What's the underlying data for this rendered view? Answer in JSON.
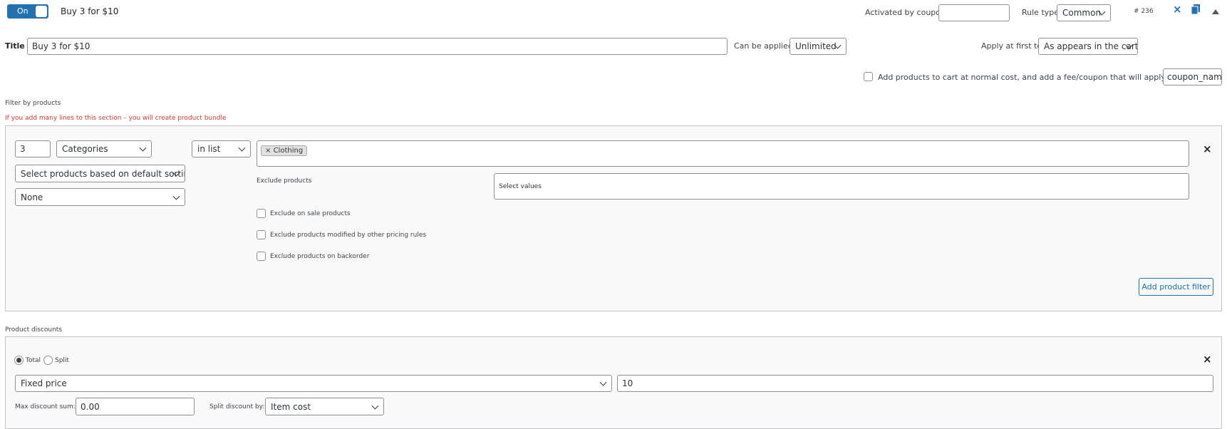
{
  "header": {
    "toggle_label": "On",
    "rule_name": "Buy 3 for $10",
    "activated_by_coupon_label": "Activated by coupon",
    "activated_by_coupon_value": "",
    "rule_type_label": "Rule type",
    "rule_type_value": "Common",
    "rule_id": "# 236"
  },
  "title_row": {
    "title_label": "Title",
    "title_value": "Buy 3 for $10",
    "can_be_applied_label": "Can be applied:",
    "can_be_applied_value": "Unlimited",
    "apply_first_label": "Apply at first to:",
    "apply_first_value": "As appears in the cart"
  },
  "fee_row": {
    "label": "Add products to cart at normal cost, and add a fee/coupon that will apply that cost",
    "coupon_value": "coupon_name"
  },
  "filter_section": {
    "title": "Filter by products",
    "warning": "If you add many lines to this section – you will create product bundle",
    "qty": "3",
    "filter_type": "Categories",
    "condition": "in list",
    "selected_tag": "Clothing",
    "sorting": "Select products based on default sorting",
    "none_option": "None",
    "exclude_products_label": "Exclude products",
    "exclude_placeholder": "Select values",
    "exclude_on_sale": "Exclude on sale products",
    "exclude_modified": "Exclude products modified by other pricing rules",
    "exclude_backorder": "Exclude products on backorder",
    "add_filter_button": "Add product filter"
  },
  "discount_section": {
    "title": "Product discounts",
    "total_label": "Total",
    "split_label": "Split",
    "discount_type": "Fixed price",
    "discount_value": "10",
    "max_sum_label": "Max discount sum:",
    "max_sum_value": "0.00",
    "split_by_label": "Split discount by:",
    "split_by_value": "Item cost"
  },
  "colors": {
    "accent": "#2271b1",
    "warning": "#d63638",
    "panel_bg": "#f9f9f9"
  }
}
